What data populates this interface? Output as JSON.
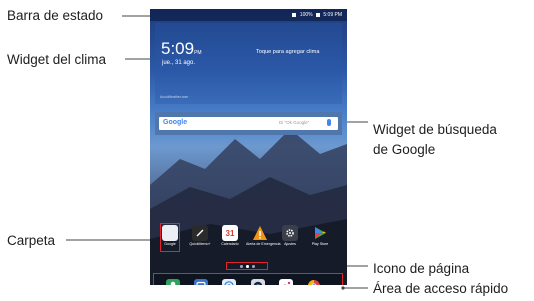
{
  "callouts": {
    "status_bar": "Barra de estado",
    "weather_widget": "Widget del clima",
    "search_widget_line1": "Widget de búsqueda",
    "search_widget_line2": "de Google",
    "folder": "Carpeta",
    "page_icon": "Icono de página",
    "quick_access": "Área de acceso rápido"
  },
  "screen": {
    "status": {
      "battery": "100%",
      "time": "5:09 PM"
    },
    "weather": {
      "time": "5:09",
      "ampm": "PM",
      "date": "jue., 31 ago.",
      "hint": "Toque para agregar clima",
      "credit": "AccuWeather.com"
    },
    "search": {
      "logo": "Google",
      "placeholder": "Di \"Ok Google\""
    },
    "apps": [
      {
        "label": "Google",
        "icon": "google-folder-icon",
        "color": "#d23f31"
      },
      {
        "label": "QuickMemo+",
        "icon": "quickmemo-icon",
        "color": "#2b2b2b"
      },
      {
        "label": "Calendario",
        "icon": "calendar-icon",
        "color": "#ffffff",
        "text": "31"
      },
      {
        "label": "Alerta de Emergencia",
        "icon": "emergency-alert-icon",
        "color": "#f29418"
      },
      {
        "label": "Ajustes",
        "icon": "settings-icon",
        "color": "#3a3f4a"
      },
      {
        "label": "Play Store",
        "icon": "play-store-icon",
        "color": "#ffffff"
      }
    ],
    "dock_icons": [
      "contacts-icon",
      "messaging-icon",
      "internet-icon",
      "camera-icon",
      "gallery-icon",
      "chrome-icon"
    ]
  },
  "accent_color": "#e0242c"
}
